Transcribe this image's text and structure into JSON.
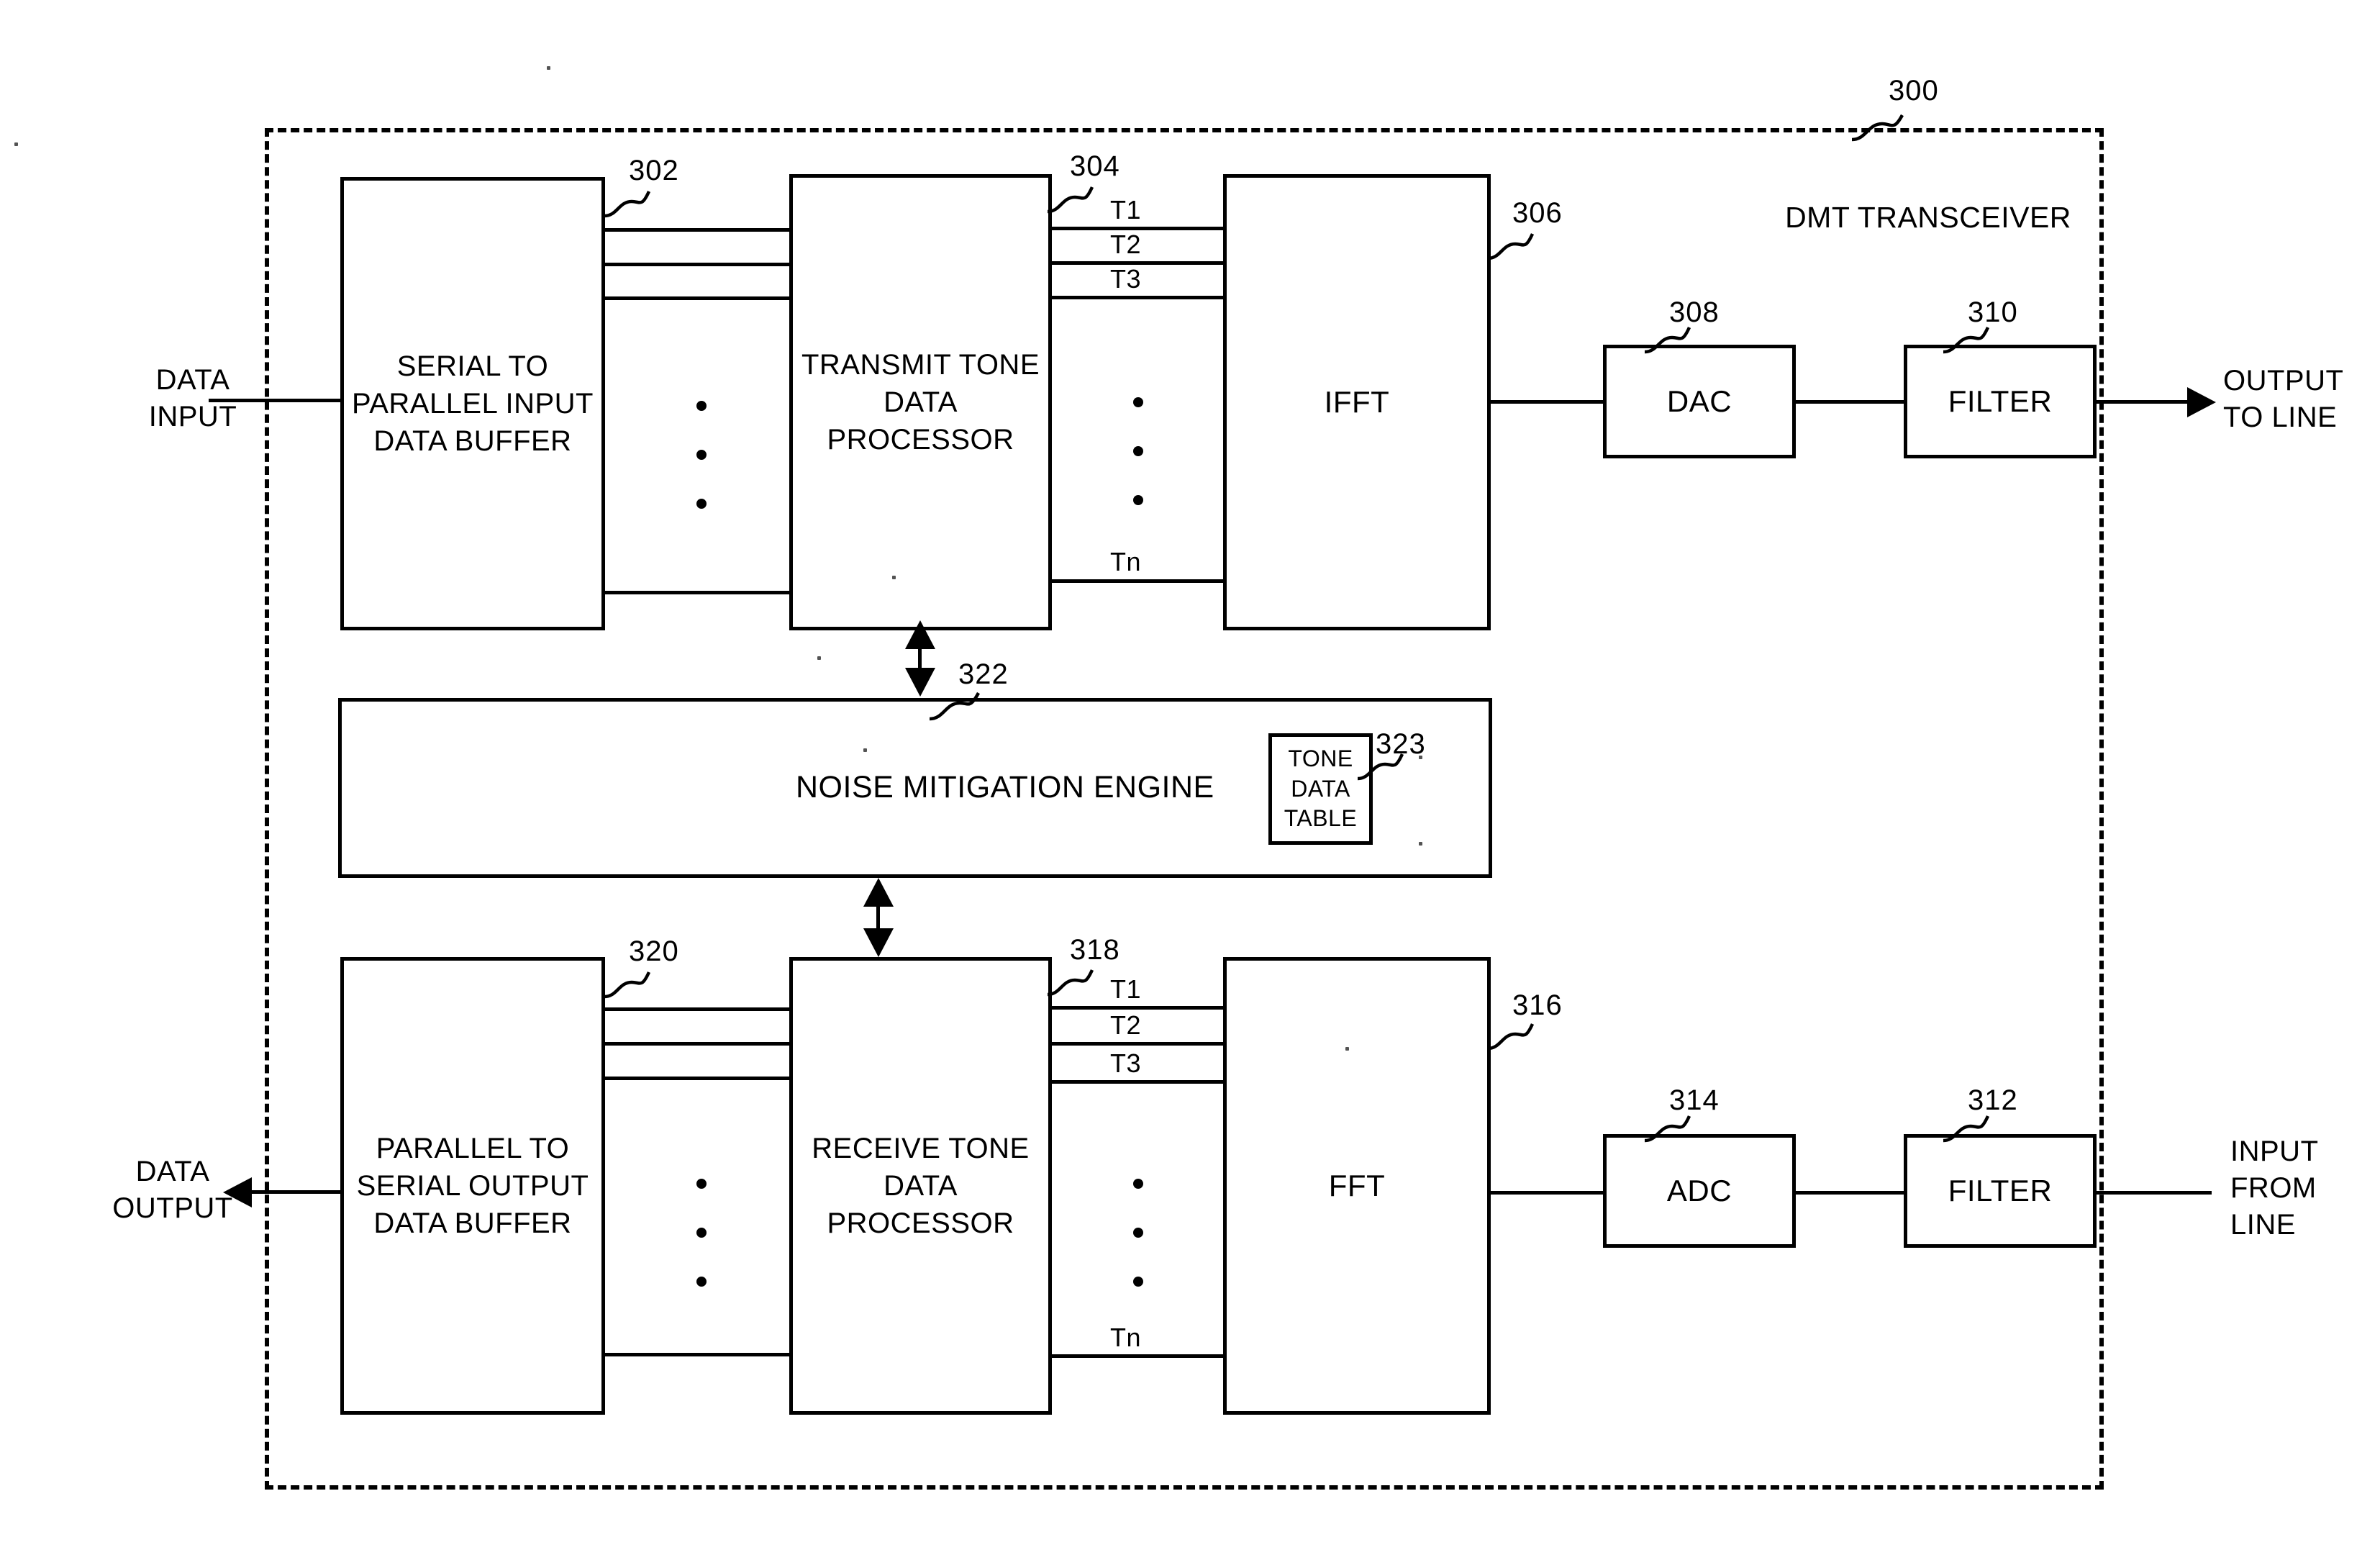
{
  "figure": {
    "system_label": "DMT TRANSCEIVER",
    "system_ref": "300"
  },
  "io": {
    "data_input": "DATA\nINPUT",
    "data_output": "DATA\nOUTPUT",
    "output_to_line": "OUTPUT\nTO LINE",
    "input_from_line": "INPUT\nFROM\nLINE"
  },
  "transmit_path": {
    "serial_to_parallel": {
      "label": "SERIAL TO\nPARALLEL\nINPUT DATA\nBUFFER",
      "ref": "302"
    },
    "tone_processor": {
      "label": "TRANSMIT\nTONE DATA\nPROCESSOR",
      "ref": "304"
    },
    "ifft": {
      "label": "IFFT",
      "ref": "306"
    },
    "dac": {
      "label": "DAC",
      "ref": "308"
    },
    "filter": {
      "label": "FILTER",
      "ref": "310"
    },
    "tones": [
      "T1",
      "T2",
      "T3",
      "Tn"
    ]
  },
  "receive_path": {
    "parallel_to_serial": {
      "label": "PARALLEL\nTO SERIAL\nOUTPUT\nDATA\nBUFFER",
      "ref": "320"
    },
    "tone_processor": {
      "label": "RECEIVE\nTONE DATA\nPROCESSOR",
      "ref": "318"
    },
    "fft": {
      "label": "FFT",
      "ref": "316"
    },
    "adc": {
      "label": "ADC",
      "ref": "314"
    },
    "filter": {
      "label": "FILTER",
      "ref": "312"
    },
    "tones": [
      "T1",
      "T2",
      "T3",
      "Tn"
    ]
  },
  "noise_engine": {
    "label": "NOISE MITIGATION ENGINE",
    "ref": "322",
    "tone_data_table": {
      "label": "TONE\nDATA\nTABLE",
      "ref": "323"
    }
  },
  "colors": {
    "ink": "#000000",
    "paper": "#ffffff"
  }
}
